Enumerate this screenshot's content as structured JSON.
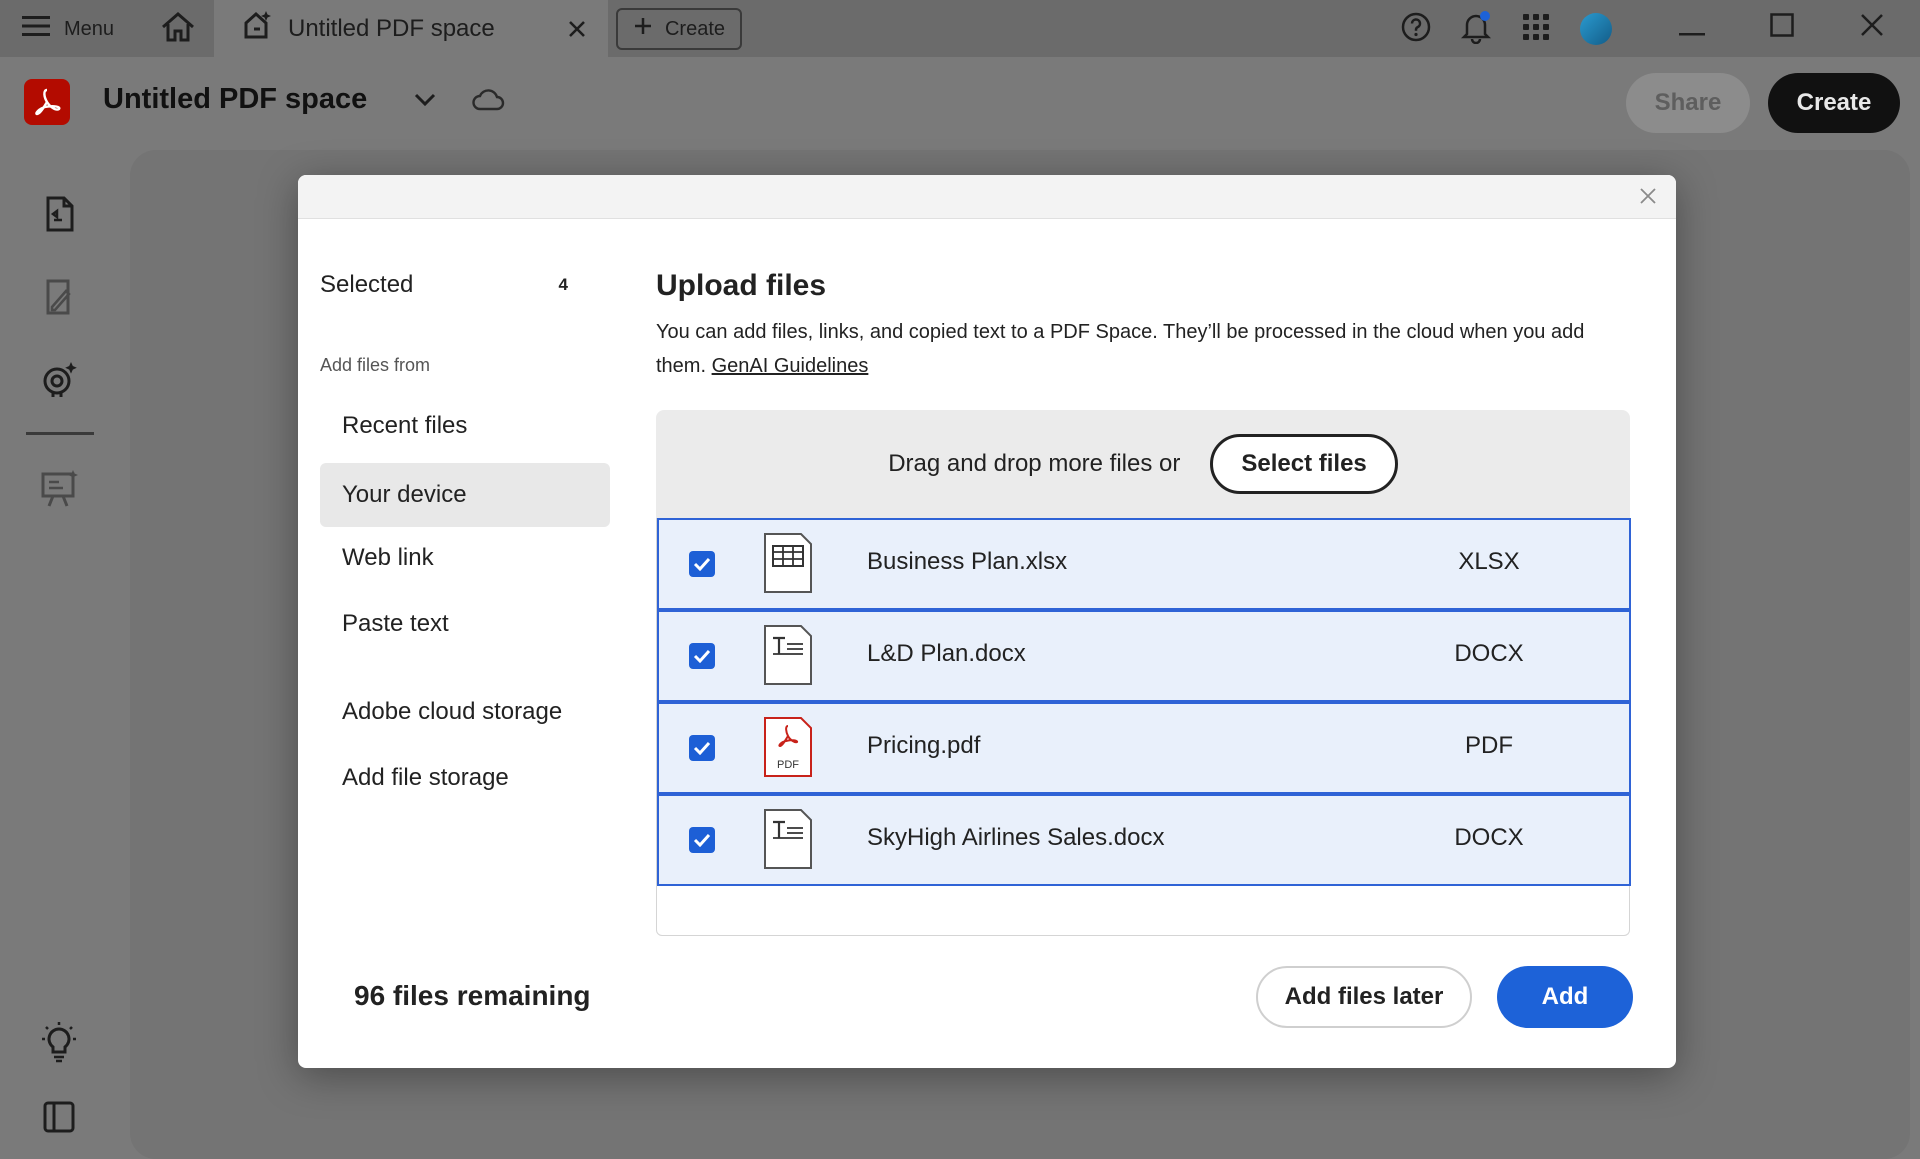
{
  "titlebar": {
    "menu_label": "Menu",
    "tab_title": "Untitled PDF space",
    "create_label": "Create",
    "icons": [
      "menu-icon",
      "home-icon",
      "pdf-space-icon",
      "close-icon",
      "plus-icon",
      "help-icon",
      "bell-icon",
      "apps-grid-icon",
      "avatar",
      "minimize-icon",
      "maximize-icon",
      "close-window-icon"
    ]
  },
  "appbar": {
    "title": "Untitled PDF space",
    "share_label": "Share",
    "create_label": "Create"
  },
  "rail": {
    "icons": [
      "documents-icon",
      "edit-document-icon",
      "ai-assistant-icon",
      "presentation-icon",
      "lightbulb-icon",
      "panel-toggle-icon"
    ]
  },
  "modal": {
    "sidebar": {
      "selected_label": "Selected",
      "selected_count": "4",
      "caption": "Add files from",
      "items": [
        {
          "label": "Recent files"
        },
        {
          "label": "Your device"
        },
        {
          "label": "Web link"
        },
        {
          "label": "Paste text"
        },
        {
          "label": "Adobe cloud storage"
        },
        {
          "label": "Add file storage"
        }
      ],
      "active_item": "Your device"
    },
    "title": "Upload files",
    "description": "You can add files, links, and copied text to a PDF Space. They’ll be processed in the cloud when you add them.",
    "guidelines_link": "GenAI Guidelines",
    "dropzone_text": "Drag and drop more files or",
    "select_files_label": "Select files",
    "files": [
      {
        "name": "Business Plan.xlsx",
        "type": "XLSX",
        "checked": true,
        "icon": "spreadsheet-file-icon"
      },
      {
        "name": "L&D Plan.docx",
        "type": "DOCX",
        "checked": true,
        "icon": "text-file-icon"
      },
      {
        "name": "Pricing.pdf",
        "type": "PDF",
        "checked": true,
        "icon": "pdf-file-icon",
        "icon_label": "PDF"
      },
      {
        "name": "SkyHigh Airlines Sales.docx",
        "type": "DOCX",
        "checked": true,
        "icon": "text-file-icon"
      }
    ],
    "remaining": "96 files remaining",
    "add_later_label": "Add files later",
    "add_label": "Add"
  },
  "colors": {
    "accent_blue": "#1d62d8",
    "row_selected_bg": "#e9f0fb",
    "adobe_red": "#b30b00"
  }
}
